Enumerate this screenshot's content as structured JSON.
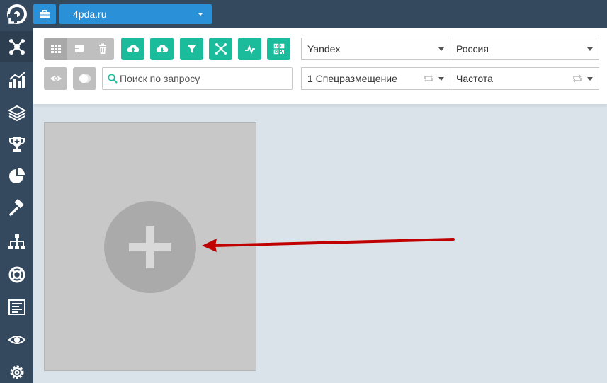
{
  "header": {
    "site_name": "4pda.ru",
    "logo_icon": "app-logo-icon",
    "briefcase_icon": "briefcase-icon"
  },
  "sidebar": {
    "items": [
      {
        "name": "network-icon",
        "active": true
      },
      {
        "name": "chart-icon"
      },
      {
        "name": "layers-icon"
      },
      {
        "name": "trophy-icon"
      },
      {
        "name": "pie-chart-icon"
      },
      {
        "name": "gavel-icon"
      },
      {
        "name": "sitemap-icon"
      },
      {
        "name": "lifebuoy-icon"
      },
      {
        "name": "report-icon"
      },
      {
        "name": "eye-icon"
      },
      {
        "name": "gear-icon"
      }
    ]
  },
  "toolbar": {
    "search_placeholder": "Поиск по запросу",
    "engine": "Yandex",
    "region": "Россия",
    "position": "1 Спецразмещение",
    "sort": "Частота",
    "colors": {
      "teal": "#1abc9c",
      "blue": "#2a90d8",
      "dark": "#34495e"
    }
  },
  "content": {
    "add_widget_icon": "plus-icon"
  }
}
